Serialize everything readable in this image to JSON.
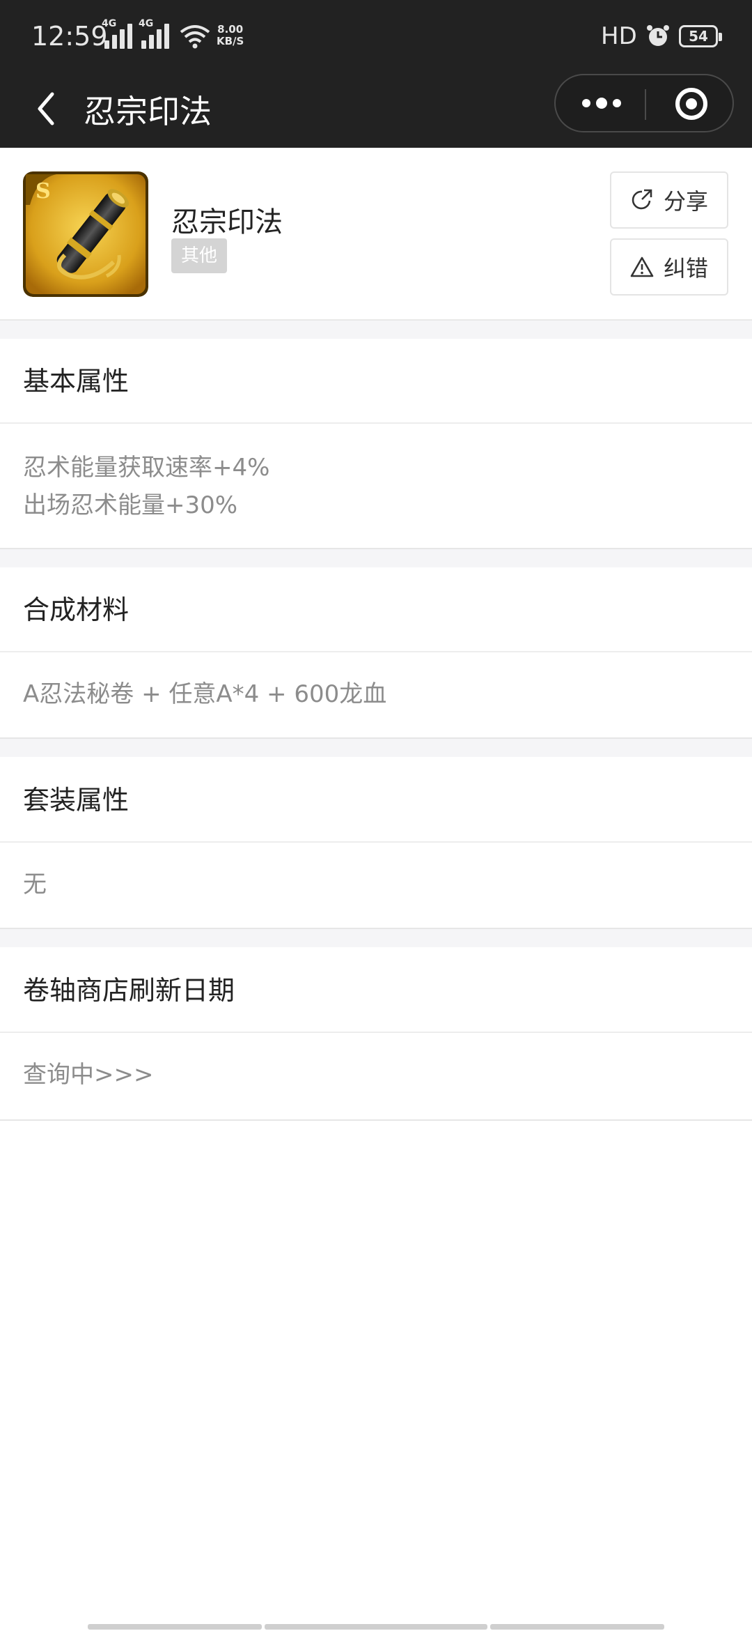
{
  "status_bar": {
    "time": "12:59",
    "network_1": "4G",
    "network_2": "4G",
    "speed_value": "8.00",
    "speed_unit": "KB/S",
    "hd_label": "HD",
    "battery": "54"
  },
  "nav": {
    "title": "忍宗印法"
  },
  "item": {
    "name": "忍宗印法",
    "tag": "其他",
    "share_label": "分享",
    "report_label": "纠错",
    "icon": "scroll-item-icon"
  },
  "sections": {
    "basic": {
      "title": "基本属性",
      "lines": [
        "忍术能量获取速率+4%",
        "出场忍术能量+30%"
      ]
    },
    "materials": {
      "title": "合成材料",
      "text": "A忍法秘卷 + 任意A*4 + 600龙血"
    },
    "set": {
      "title": "套装属性",
      "text": "无"
    },
    "shop": {
      "title": "卷轴商店刷新日期",
      "text": "查询中>>>"
    }
  },
  "colors": {
    "topbar": "#222222",
    "tag_bg": "#d4d4d4",
    "muted_text": "#8c8c8c"
  }
}
